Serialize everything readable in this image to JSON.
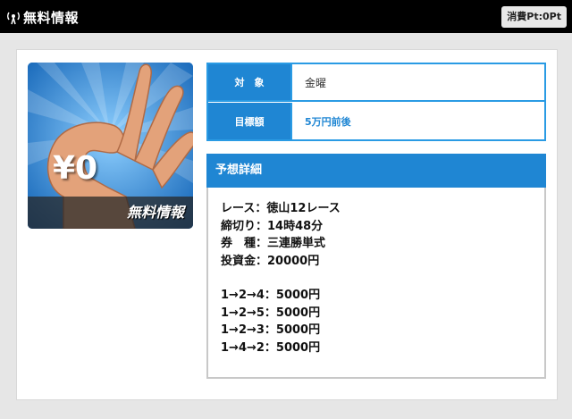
{
  "header": {
    "title": "無料情報",
    "points_label": "消費Pt:0Pt"
  },
  "thumbnail": {
    "caption": "無料情報",
    "yen_text": "¥0"
  },
  "info": [
    {
      "label": "対　象",
      "value": "金曜"
    },
    {
      "label": "目標額",
      "value": "5万円前後"
    }
  ],
  "detail": {
    "header": "予想詳細",
    "lines": [
      "レース：徳山12レース",
      "締切り：14時48分",
      "券　種：三連勝単式",
      "投資金：20000円"
    ],
    "bets": [
      "1→2→4：5000円",
      "1→2→5：5000円",
      "1→2→3：5000円",
      "1→4→2：5000円"
    ]
  }
}
